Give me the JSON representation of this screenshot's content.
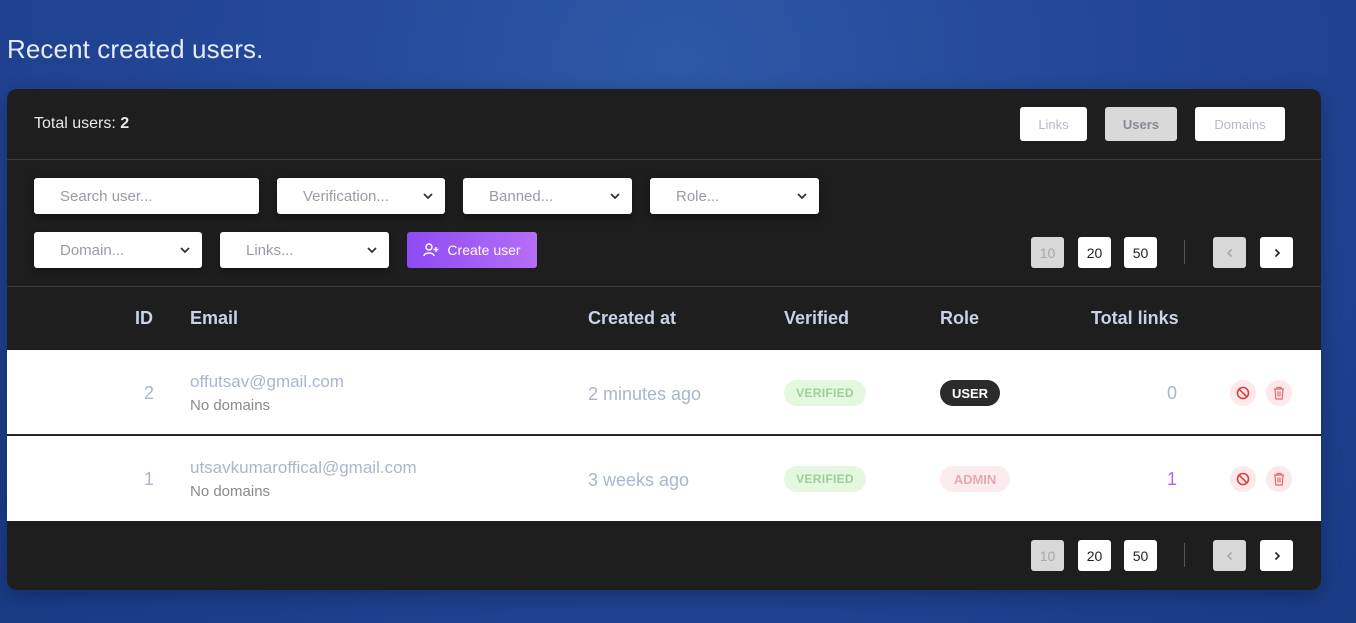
{
  "page_title": "Recent created users.",
  "header": {
    "total_label": "Total users:",
    "total_count": "2",
    "tabs": [
      {
        "label": "Links",
        "active": false
      },
      {
        "label": "Users",
        "active": true
      },
      {
        "label": "Domains",
        "active": false
      }
    ]
  },
  "filters": {
    "search_placeholder": "Search user...",
    "verification": "Verification...",
    "banned": "Banned...",
    "role": "Role...",
    "domain": "Domain...",
    "links": "Links...",
    "create_label": "Create user"
  },
  "pagination": {
    "sizes": [
      "10",
      "20",
      "50"
    ],
    "active_size": "10"
  },
  "columns": [
    "ID",
    "Email",
    "Created at",
    "Verified",
    "Role",
    "Total links"
  ],
  "rows": [
    {
      "id": "2",
      "email": "offutsav@gmail.com",
      "domains": "No domains",
      "created": "2 minutes ago",
      "verified": "VERIFIED",
      "role": "USER",
      "total_links": "0"
    },
    {
      "id": "1",
      "email": "utsavkumaroffical@gmail.com",
      "domains": "No domains",
      "created": "3 weeks ago",
      "verified": "VERIFIED",
      "role": "ADMIN",
      "total_links": "1"
    }
  ],
  "colors": {
    "accent": "#9b59f5",
    "danger": "#e23b3b",
    "links_zero": "#aab6cc",
    "links_nonzero": "#a46ef0"
  }
}
